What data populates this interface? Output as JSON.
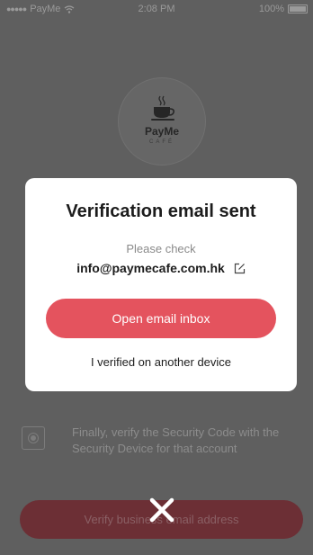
{
  "status_bar": {
    "carrier": "PayMe",
    "time": "2:08 PM",
    "battery": "100%"
  },
  "logo": {
    "name": "PayMe",
    "sub": "CAFÉ"
  },
  "background": {
    "step_text": "Finally, verify the Security Code with the Security Device for that account",
    "verify_button_label": "Verify business email address"
  },
  "modal": {
    "title": "Verification email sent",
    "subtitle": "Please check",
    "email": "info@paymecafe.com.hk",
    "open_inbox_label": "Open email inbox",
    "verified_other_label": "I verified on another device"
  },
  "colors": {
    "accent": "#e4535e",
    "overlay": "#5f5f5f"
  }
}
